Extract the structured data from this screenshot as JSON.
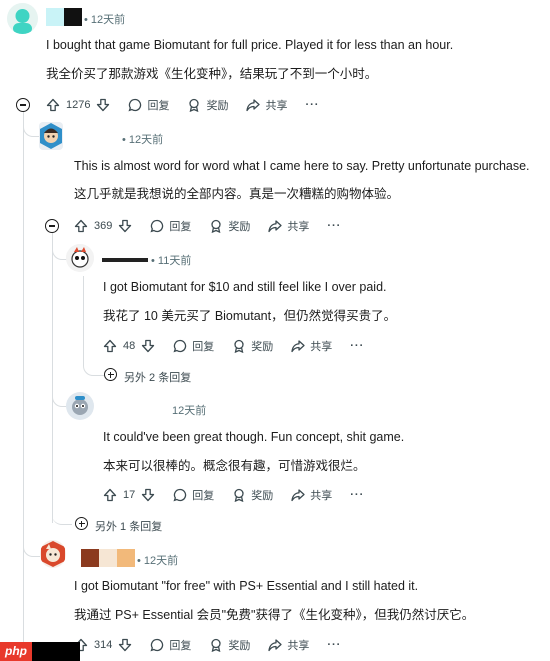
{
  "comments": [
    {
      "time": "• 12天前",
      "text_en": "I bought that game Biomutant for full price. Played it for less than an hour.",
      "text_zh": "我全价买了那款游戏《生化变种》，结果玩了不到一个小时。",
      "votes": "1276"
    },
    {
      "time": "• 12天前",
      "text_en": "This is almost word for word what I came here to say. Pretty unfortunate purchase.",
      "text_zh": "这几乎就是我想说的全部内容。真是一次糟糕的购物体验。",
      "votes": "369"
    },
    {
      "time": "• 11天前",
      "text_en": "I got Biomutant for $10 and still feel like I over paid.",
      "text_zh": "我花了 10 美元买了 Biomutant，但仍然觉得买贵了。",
      "votes": "48",
      "more_replies": "另外 2 条回复"
    },
    {
      "time": "12天前",
      "text_en": "It could've been great though. Fun concept, shit game.",
      "text_zh": "本来可以很棒的。概念很有趣，可惜游戏很烂。",
      "votes": "17",
      "more_replies": "另外 1 条回复"
    },
    {
      "time": "• 12天前",
      "text_en": "I got Biomutant \"for free\" with PS+ Essential and I still hated it.",
      "text_zh": "我通过 PS+ Essential 会员\"免费\"获得了《生化变种》，但我仍然讨厌它。",
      "votes": "314"
    }
  ],
  "actions": {
    "reply": "回复",
    "award": "奖励",
    "share": "共享",
    "more": "···"
  },
  "watermark": "php",
  "colors": {
    "accent_teal": "#3fd4c3",
    "text": "#1c1c1c",
    "muted": "#576f76",
    "thread_line": "#d9dde0"
  }
}
